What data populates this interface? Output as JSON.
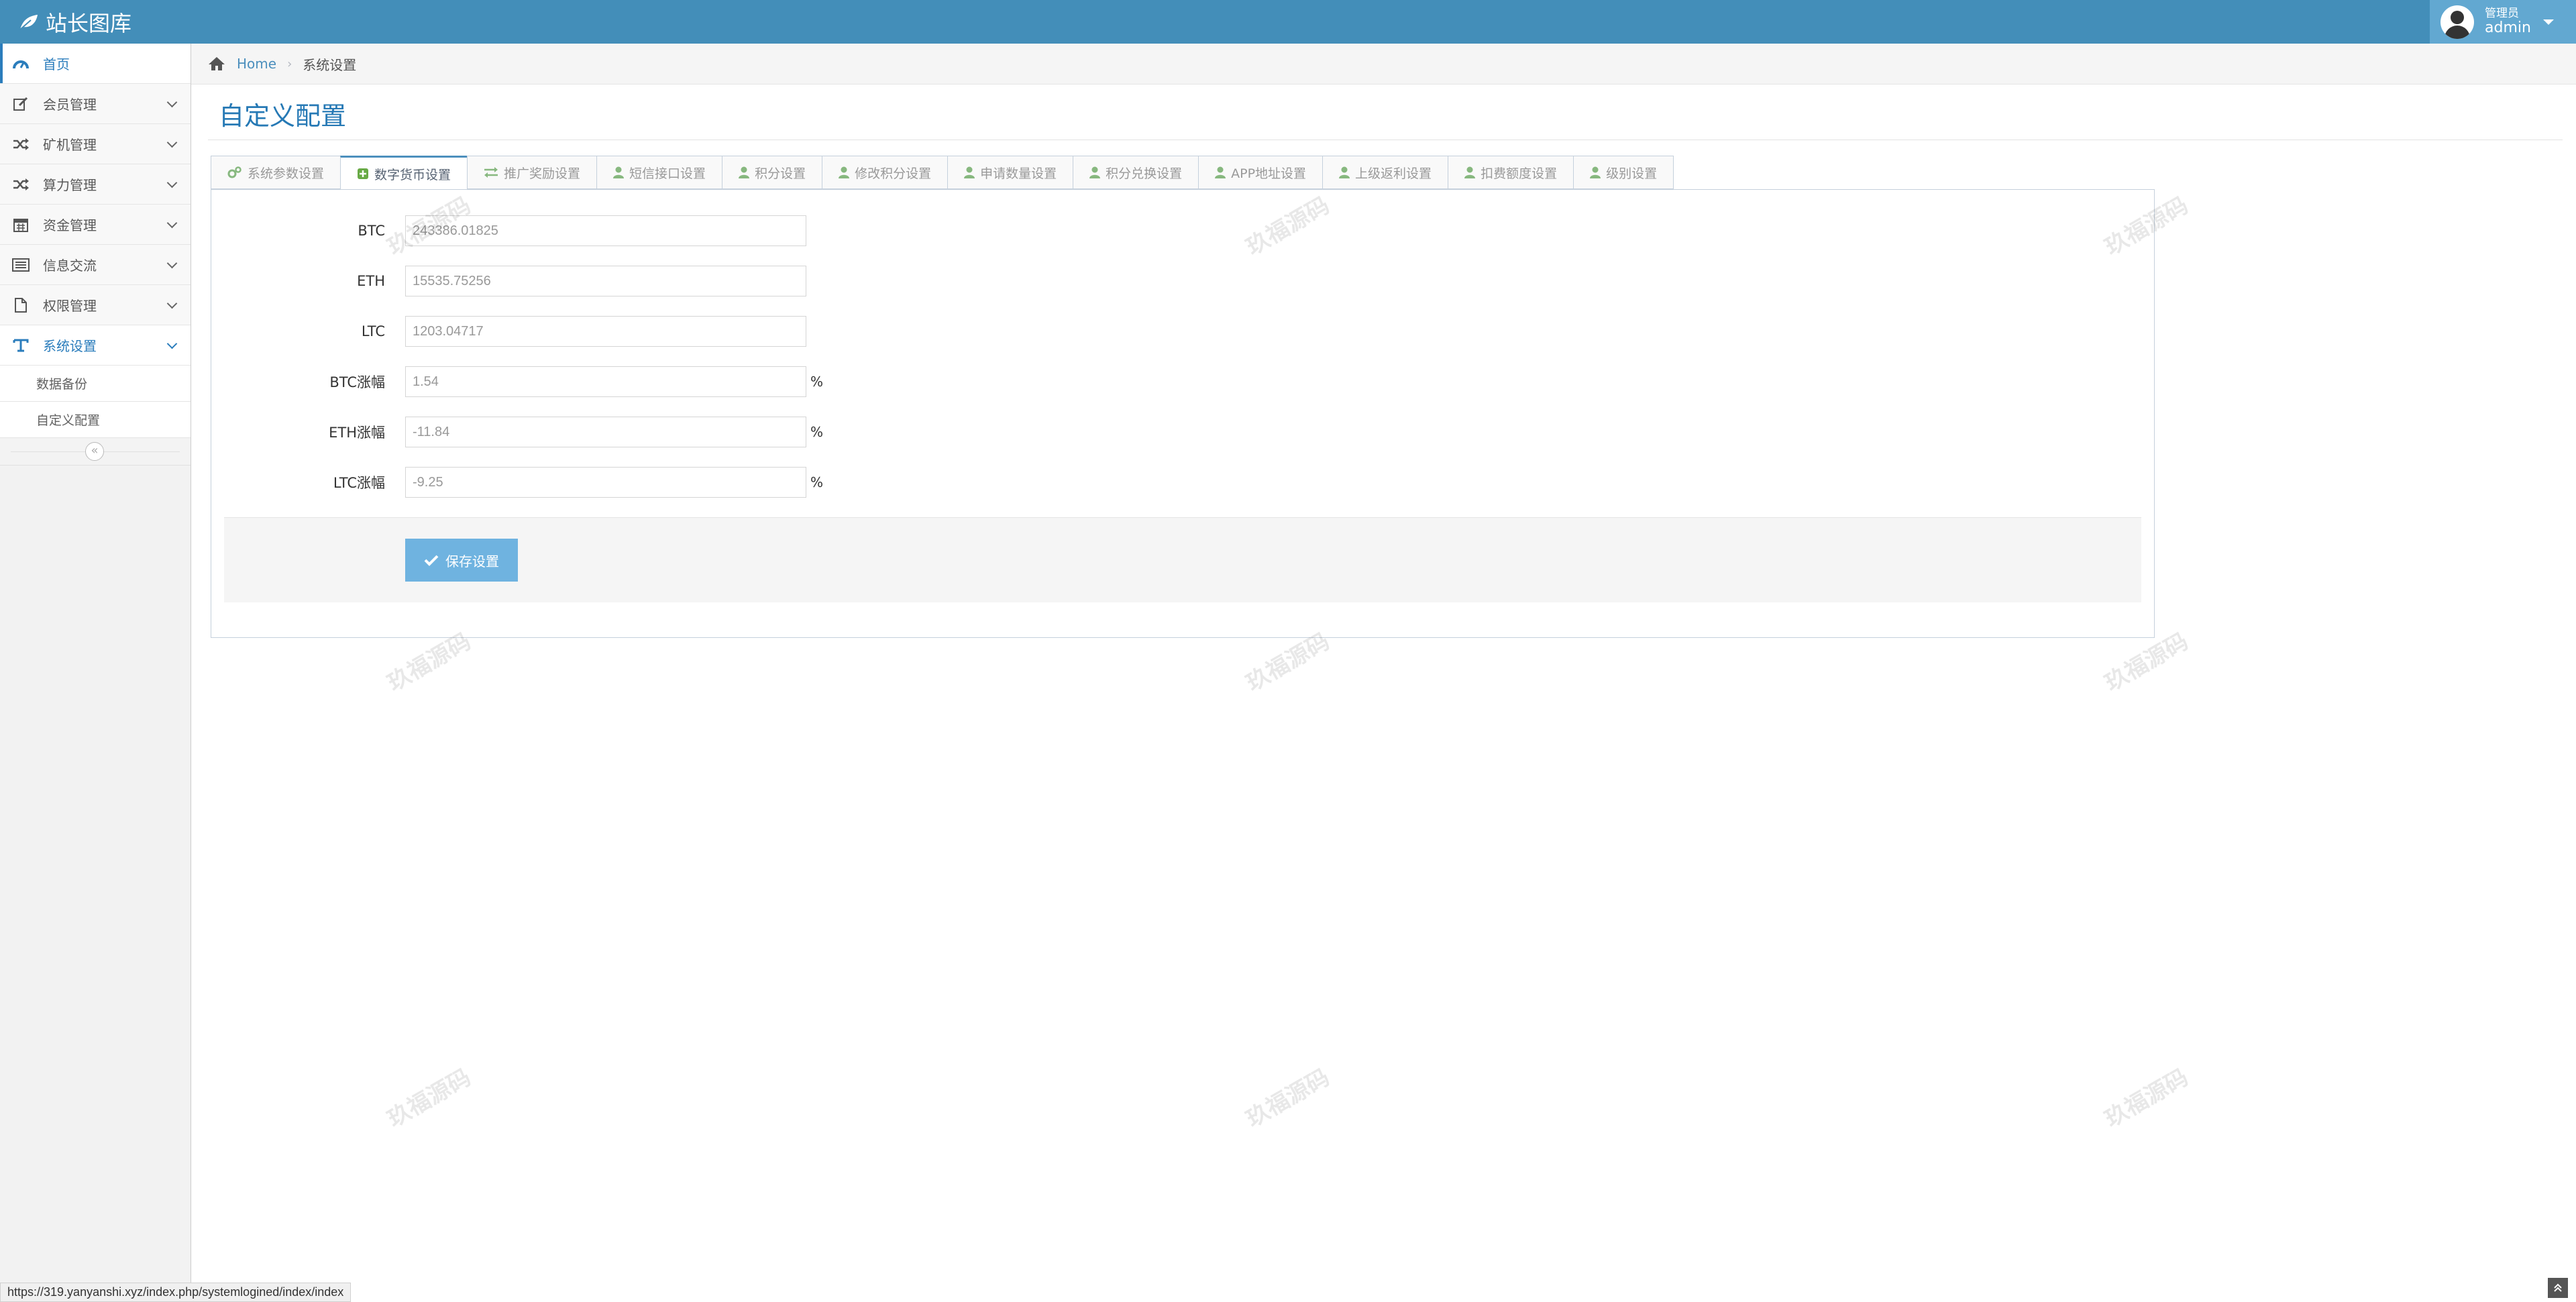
{
  "brand": {
    "title": "站长图库",
    "icon": "leaf-icon"
  },
  "user": {
    "role": "管理员",
    "name": "admin",
    "icon": "user-avatar-icon"
  },
  "sidebar": {
    "items": [
      {
        "label": "首页",
        "icon": "dashboard-icon"
      },
      {
        "label": "会员管理",
        "icon": "edit-icon"
      },
      {
        "label": "矿机管理",
        "icon": "random-icon"
      },
      {
        "label": "算力管理",
        "icon": "random-icon"
      },
      {
        "label": "资金管理",
        "icon": "calendar-icon"
      },
      {
        "label": "信息交流",
        "icon": "list-icon"
      },
      {
        "label": "权限管理",
        "icon": "file-icon"
      },
      {
        "label": "系统设置",
        "icon": "text-icon"
      }
    ],
    "subitems": [
      "数据备份",
      "自定义配置"
    ],
    "collapse": "«"
  },
  "breadcrumb": {
    "home": "Home",
    "current": "系统设置"
  },
  "page": {
    "title": "自定义配置"
  },
  "tabs": [
    "系统参数设置",
    "数字货币设置",
    "推广奖励设置",
    "短信接口设置",
    "积分设置",
    "修改积分设置",
    "申请数量设置",
    "积分兑换设置",
    "APP地址设置",
    "上级返利设置",
    "扣费额度设置",
    "级别设置"
  ],
  "form": {
    "fields": [
      {
        "label": "BTC",
        "value": "243386.01825",
        "unit": ""
      },
      {
        "label": "ETH",
        "value": "15535.75256",
        "unit": ""
      },
      {
        "label": "LTC",
        "value": "1203.04717",
        "unit": ""
      },
      {
        "label": "BTC涨幅",
        "value": "1.54",
        "unit": "%"
      },
      {
        "label": "ETH涨幅",
        "value": "-11.84",
        "unit": "%"
      },
      {
        "label": "LTC涨幅",
        "value": "-9.25",
        "unit": "%"
      }
    ],
    "save_label": "保存设置"
  },
  "watermark": "玖福源码",
  "status_url": "https://319.yanyanshi.xyz/index.php/systemlogined/index/index",
  "colors": {
    "navbar": "#438eb9",
    "accent": "#2b7dbc",
    "button": "#6fb3e0"
  }
}
